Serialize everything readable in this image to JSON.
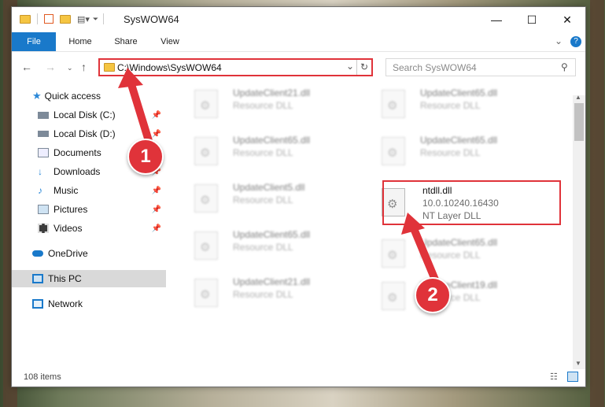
{
  "window": {
    "title": "SysWOW64",
    "controls": {
      "minimize": "—",
      "maximize": "☐",
      "close": "✕"
    }
  },
  "ribbon": {
    "tabs": [
      "File",
      "Home",
      "Share",
      "View"
    ],
    "expand_glyph": "⌄",
    "help_glyph": "?"
  },
  "address": {
    "path": "C:\\Windows\\SysWOW64",
    "search_placeholder": "Search SysWOW64"
  },
  "sidebar": {
    "items": [
      {
        "label": "Quick access",
        "icon": "star-icon"
      },
      {
        "label": "Local Disk (C:)",
        "icon": "drive-icon",
        "pinned": true
      },
      {
        "label": "Local Disk (D:)",
        "icon": "drive-icon",
        "pinned": true
      },
      {
        "label": "Documents",
        "icon": "documents-icon",
        "pinned": true
      },
      {
        "label": "Downloads",
        "icon": "download-icon",
        "pinned": true
      },
      {
        "label": "Music",
        "icon": "music-icon",
        "pinned": true
      },
      {
        "label": "Pictures",
        "icon": "pictures-icon",
        "pinned": true
      },
      {
        "label": "Videos",
        "icon": "videos-icon",
        "pinned": true
      },
      {
        "label": "OneDrive",
        "icon": "cloud-icon"
      },
      {
        "label": "This PC",
        "icon": "pc-icon",
        "selected": true
      },
      {
        "label": "Network",
        "icon": "network-icon"
      }
    ]
  },
  "files": {
    "left_column": [
      {
        "name": "UpdateClient21.dll",
        "type": "Resource DLL"
      },
      {
        "name": "UpdateClient65.dll",
        "type": "Resource DLL"
      },
      {
        "name": "UpdateClient5.dll",
        "type": "Resource DLL"
      },
      {
        "name": "UpdateClient65.dll",
        "type": "Resource DLL"
      },
      {
        "name": "UpdateClient21.dll",
        "type": "Resource DLL"
      }
    ],
    "right_column": [
      {
        "name": "UpdateClient65.dll",
        "type": "Resource DLL"
      },
      {
        "name": "UpdateClient65.dll",
        "type": "Resource DLL"
      },
      {
        "name": "ntdll.dll",
        "version": "10.0.10240.16430",
        "type": "NT Layer DLL",
        "highlighted": true
      },
      {
        "name": "UpdateClient65.dll",
        "type": "Resource DLL"
      },
      {
        "name": "UpdateClient19.dll",
        "type": "Resource DLL"
      }
    ]
  },
  "status": {
    "item_count": "108 items"
  },
  "callouts": [
    "1",
    "2"
  ],
  "colors": {
    "accent": "#1979ca",
    "highlight": "#e0333a",
    "folder": "#f5c542"
  }
}
